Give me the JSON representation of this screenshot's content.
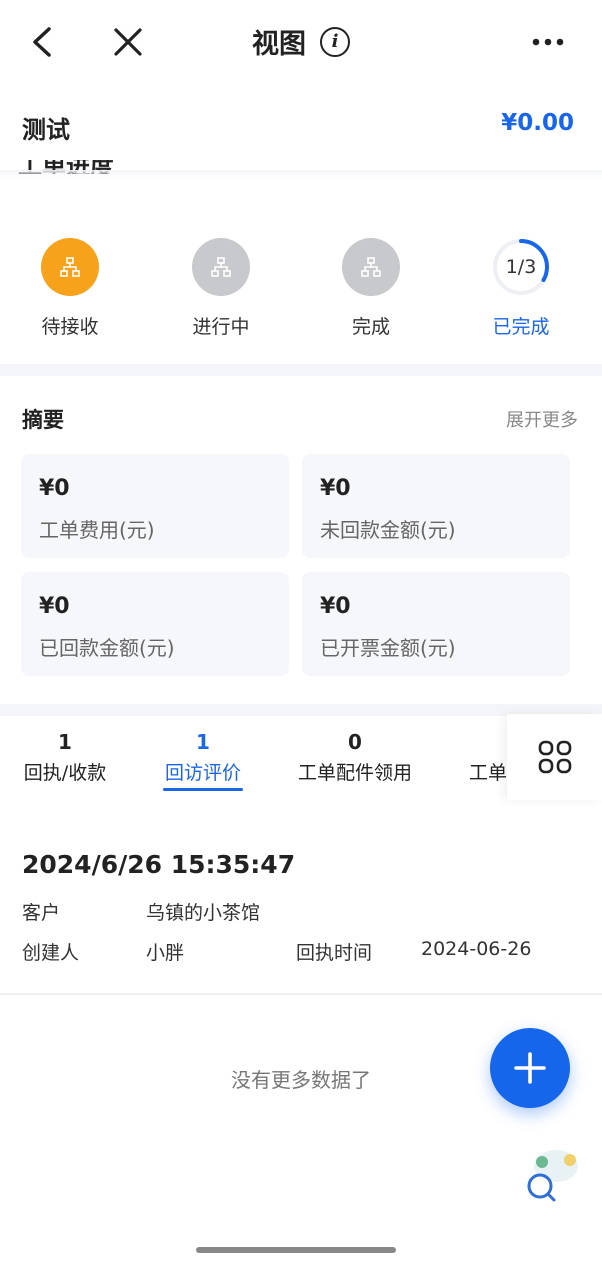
{
  "navbar": {
    "title": "视图",
    "info_glyph": "i",
    "back_icon": "chevron-left-icon",
    "close_icon": "close-icon",
    "more_icon": "more-dots-icon"
  },
  "subheader": {
    "title": "测试",
    "amount": "¥0.00"
  },
  "cut_heading": "工单进度",
  "progress": {
    "steps": [
      {
        "label": "待接收",
        "state": "active",
        "color": "#f7a21b",
        "icon": "org-chart-icon"
      },
      {
        "label": "进行中",
        "state": "inactive",
        "color": "#c8c9cc",
        "icon": "org-chart-icon"
      },
      {
        "label": "完成",
        "state": "inactive",
        "color": "#c8c9cc",
        "icon": "org-chart-icon"
      }
    ],
    "ring": {
      "text": "1/3",
      "label": "已完成",
      "completed": 1,
      "total": 3
    }
  },
  "summary": {
    "title": "摘要",
    "more_label": "展开更多",
    "cards": [
      {
        "value": "¥0",
        "label": "工单费用(元)"
      },
      {
        "value": "¥0",
        "label": "未回款金额(元)"
      },
      {
        "value": "¥0",
        "label": "已回款金额(元)"
      },
      {
        "value": "¥0",
        "label": "已开票金额(元)"
      }
    ]
  },
  "tabs": [
    {
      "count": "1",
      "label": "回执/收款",
      "active": false
    },
    {
      "count": "1",
      "label": "回访评价",
      "active": true
    },
    {
      "count": "0",
      "label": "工单配件领用",
      "active": false
    },
    {
      "count": "",
      "label": "工单",
      "active": false
    }
  ],
  "record": {
    "time": "2024/6/26 15:35:47",
    "customer_label": "客户",
    "customer_value": "乌镇的小茶馆",
    "creator_label": "创建人",
    "creator_value": "小胖",
    "receipt_label": "回执时间",
    "receipt_value": "2024-06-26"
  },
  "footer": {
    "no_more": "没有更多数据了"
  },
  "colors": {
    "accent": "#1a66e8",
    "orange": "#f7a21b",
    "gray": "#c8c9cc"
  }
}
